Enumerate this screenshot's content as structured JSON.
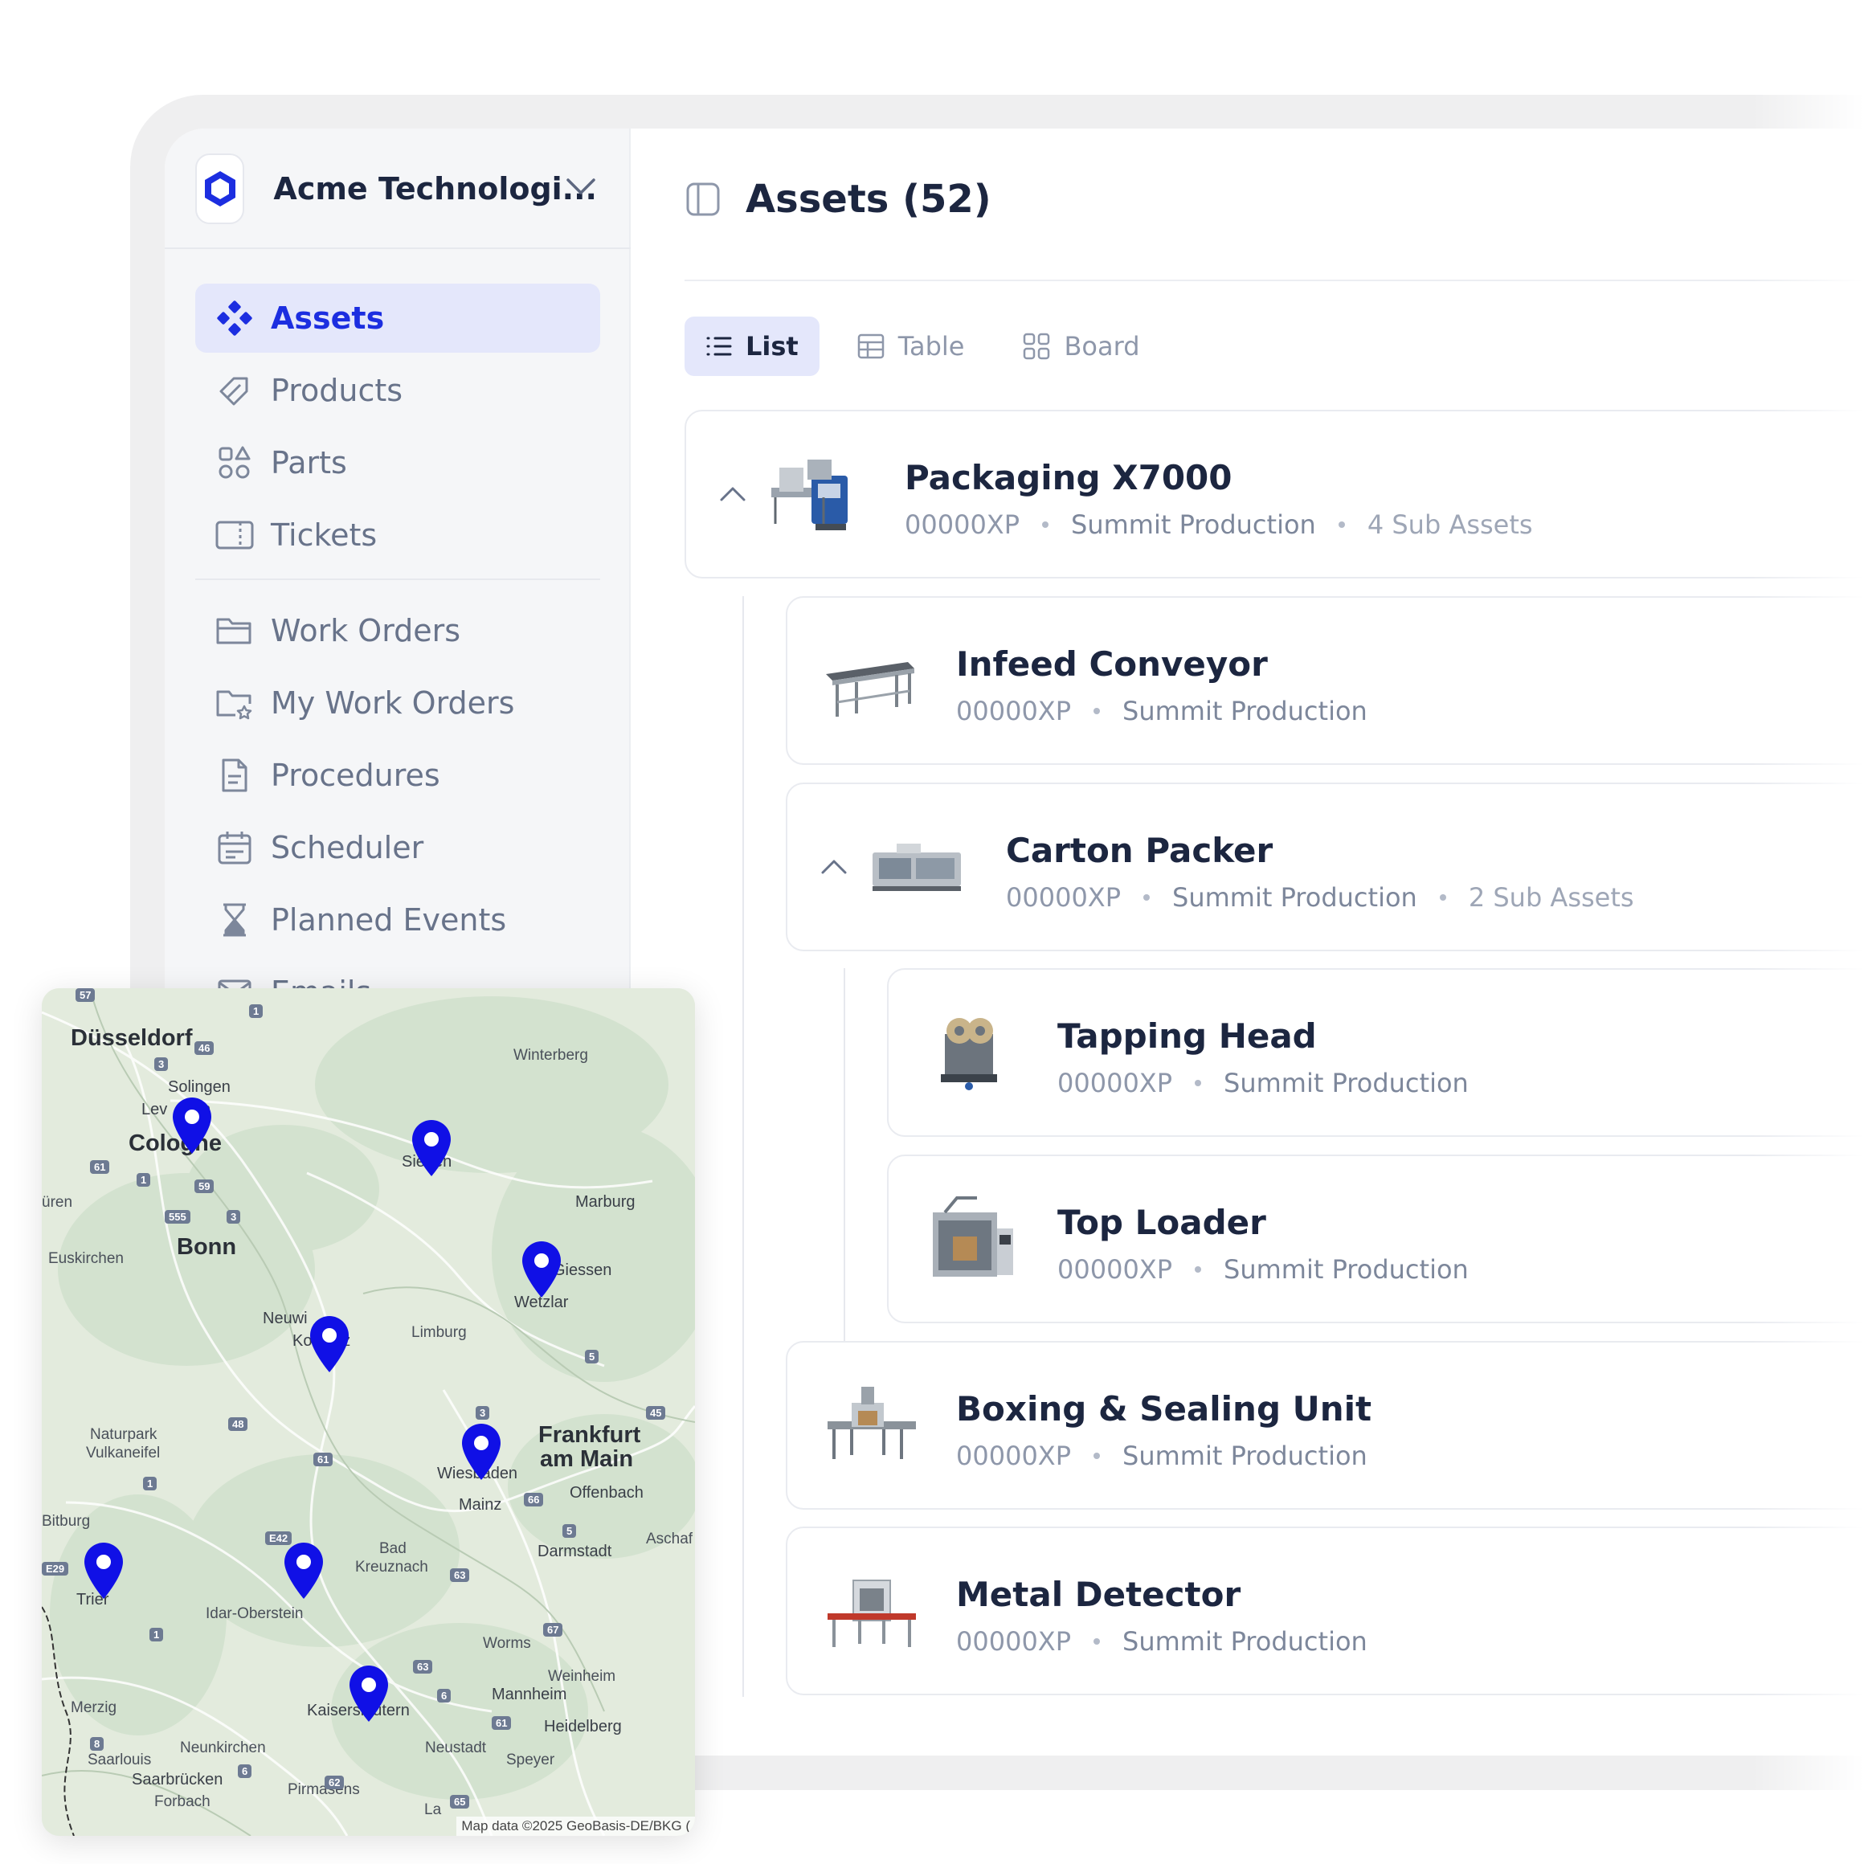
{
  "org": {
    "name": "Acme Technologi..."
  },
  "sidebar": {
    "items": [
      {
        "label": "Assets",
        "icon": "assets-icon",
        "active": true
      },
      {
        "label": "Products",
        "icon": "tag-icon"
      },
      {
        "label": "Parts",
        "icon": "parts-icon"
      },
      {
        "label": "Tickets",
        "icon": "ticket-icon"
      },
      {
        "label": "Work Orders",
        "icon": "folder-icon"
      },
      {
        "label": "My Work Orders",
        "icon": "folder-star-icon"
      },
      {
        "label": "Procedures",
        "icon": "document-icon"
      },
      {
        "label": "Scheduler",
        "icon": "calendar-icon"
      },
      {
        "label": "Planned Events",
        "icon": "hourglass-icon"
      },
      {
        "label": "Emails",
        "icon": "mail-icon"
      }
    ]
  },
  "main": {
    "title": "Assets (52)",
    "tabs": [
      {
        "label": "List",
        "active": true
      },
      {
        "label": "Table"
      },
      {
        "label": "Board"
      }
    ],
    "assets": [
      {
        "name": "Packaging X7000",
        "code": "00000XP",
        "location": "Summit Production",
        "sub": "4 Sub Assets",
        "expanded": true
      },
      {
        "name": "Infeed Conveyor",
        "code": "00000XP",
        "location": "Summit Production"
      },
      {
        "name": "Carton Packer",
        "code": "00000XP",
        "location": "Summit Production",
        "sub": "2 Sub Assets",
        "expanded": true
      },
      {
        "name": "Tapping Head",
        "code": "00000XP",
        "location": "Summit Production"
      },
      {
        "name": "Top Loader",
        "code": "00000XP",
        "location": "Summit Production"
      },
      {
        "name": "Boxing & Sealing Unit",
        "code": "00000XP",
        "location": "Summit Production"
      },
      {
        "name": "Metal Detector",
        "code": "00000XP",
        "location": "Summit Production"
      }
    ]
  },
  "map": {
    "cities": [
      "Düsseldorf",
      "Solingen",
      "Lev",
      "en",
      "Cologne",
      "Winterberg",
      "Siegen",
      "üren",
      "Marburg",
      "Bonn",
      "Euskirchen",
      "Giessen",
      "Wetzlar",
      "Neuwi",
      "Koblenz",
      "Limburg",
      "Naturpark",
      "Vulkaneifel",
      "Frankfurt",
      "am Main",
      "Wiesbaden",
      "Offenbach",
      "Mainz",
      "Bitburg",
      "Bad",
      "Kreuznach",
      "Darmstadt",
      "Aschaf",
      "Trier",
      "Idar-Oberstein",
      "Worms",
      "Weinheim",
      "Mannheim",
      "Merzig",
      "Kaiserslautern",
      "Heidelberg",
      "Neunkirchen",
      "Neustadt",
      "Saarlouis",
      "Speyer",
      "Saarbrücken",
      "Pirmasens",
      "Forbach",
      "La"
    ],
    "highways": [
      "57",
      "1",
      "46",
      "3",
      "61",
      "1",
      "59",
      "555",
      "3",
      "3",
      "5",
      "45",
      "48",
      "61",
      "1",
      "66",
      "5",
      "E42",
      "E29",
      "63",
      "1",
      "67",
      "63",
      "6",
      "61",
      "8",
      "6",
      "62",
      "65"
    ],
    "attribution": "Map data ©2025 GeoBasis-DE/BKG (",
    "pin_color": "#1010e6"
  },
  "colors": {
    "accent": "#1c2ee0",
    "active_bg": "#e4e7fb"
  }
}
